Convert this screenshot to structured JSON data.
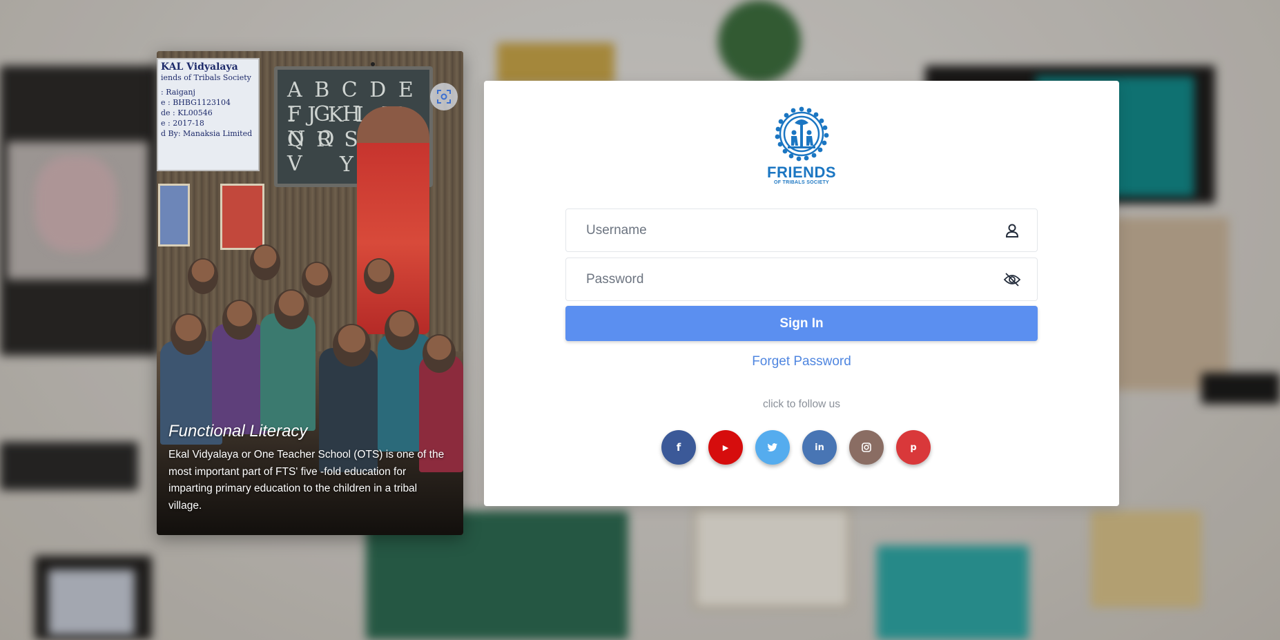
{
  "card": {
    "title": "Functional Literacy",
    "description": "Ekal Vidyalaya or One Teacher School (OTS) is one of the most important part of FTS' five -fold education for imparting primary education to the children in a tribal village.",
    "photo_sign": [
      "KAL Vidyalaya",
      "iends of Tribals Society",
      ": Raiganj",
      "e : BHBG1123104",
      "de : KL00546",
      "e : 2017-18",
      "d By: Manaksia Limited"
    ],
    "board_letters": [
      "A B C D E F G H",
      "I J K L M N O",
      "Q R S T U V",
      "Y Z"
    ]
  },
  "logo": {
    "brand": "FRIENDS",
    "subtitle": "OF TRIBALS SOCIETY",
    "color": "#1b76c2"
  },
  "login": {
    "username_placeholder": "Username",
    "password_placeholder": "Password",
    "sign_in_label": "Sign In",
    "forget_label": "Forget Password",
    "follow_label": "click to follow us"
  },
  "socials": [
    {
      "name": "facebook",
      "glyph": "f",
      "color": "#3b5998"
    },
    {
      "name": "youtube",
      "glyph": "▶",
      "color": "#d60d0d"
    },
    {
      "name": "twitter",
      "glyph": "🐦",
      "color": "#55acee"
    },
    {
      "name": "linkedin",
      "glyph": "in",
      "color": "#4875b4"
    },
    {
      "name": "instagram",
      "glyph": "◎",
      "color": "#8a6d63"
    },
    {
      "name": "pinterest",
      "glyph": "p",
      "color": "#d9383a"
    }
  ],
  "colors": {
    "primary": "#5b8ff0",
    "link": "#4f86e0"
  }
}
